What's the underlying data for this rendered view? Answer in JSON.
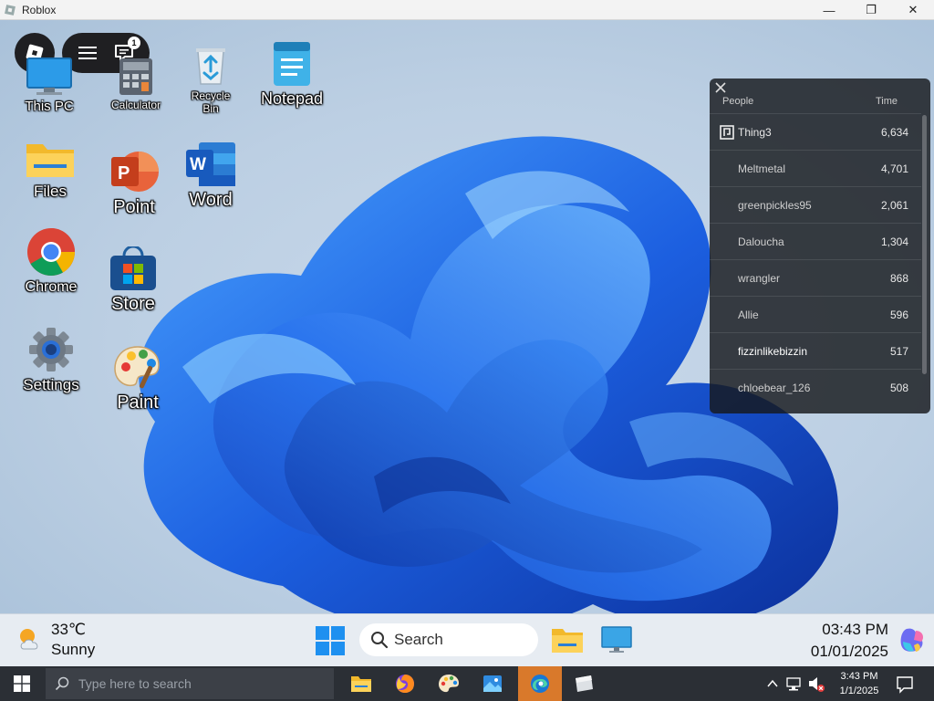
{
  "window": {
    "title": "Roblox",
    "minimize": "—",
    "maximize": "❐",
    "close": "✕"
  },
  "roblox_menu": {
    "chat_badge": "1"
  },
  "desktop_icons": [
    {
      "label": "This PC"
    },
    {
      "label": "Calculator"
    },
    {
      "label": "Recycle Bin"
    },
    {
      "label": "Notepad"
    },
    {
      "label": "Files"
    },
    {
      "label": "Point"
    },
    {
      "label": "Word"
    },
    {
      "label": "Chrome"
    },
    {
      "label": "Store"
    },
    {
      "label": "Settings"
    },
    {
      "label": "Paint"
    }
  ],
  "leaderboard": {
    "col_people": "People",
    "col_time": "Time",
    "rows": [
      {
        "name": "Thing3",
        "value": "6,634"
      },
      {
        "name": "Meltmetal",
        "value": "4,701"
      },
      {
        "name": "greenpickles95",
        "value": "2,061"
      },
      {
        "name": "Daloucha",
        "value": "1,304"
      },
      {
        "name": "wrangler",
        "value": "868"
      },
      {
        "name": "Allie",
        "value": "596"
      },
      {
        "name": "fizzinlikebizzin",
        "value": "517"
      },
      {
        "name": "chloebear_126",
        "value": "508"
      }
    ]
  },
  "inner_taskbar": {
    "temperature": "33℃",
    "weather": "Sunny",
    "search_label": "Search",
    "time": "03:43 PM",
    "date": "01/01/2025"
  },
  "outer_taskbar": {
    "search_placeholder": "Type here to search",
    "time": "3:43 PM",
    "date": "1/1/2025"
  }
}
